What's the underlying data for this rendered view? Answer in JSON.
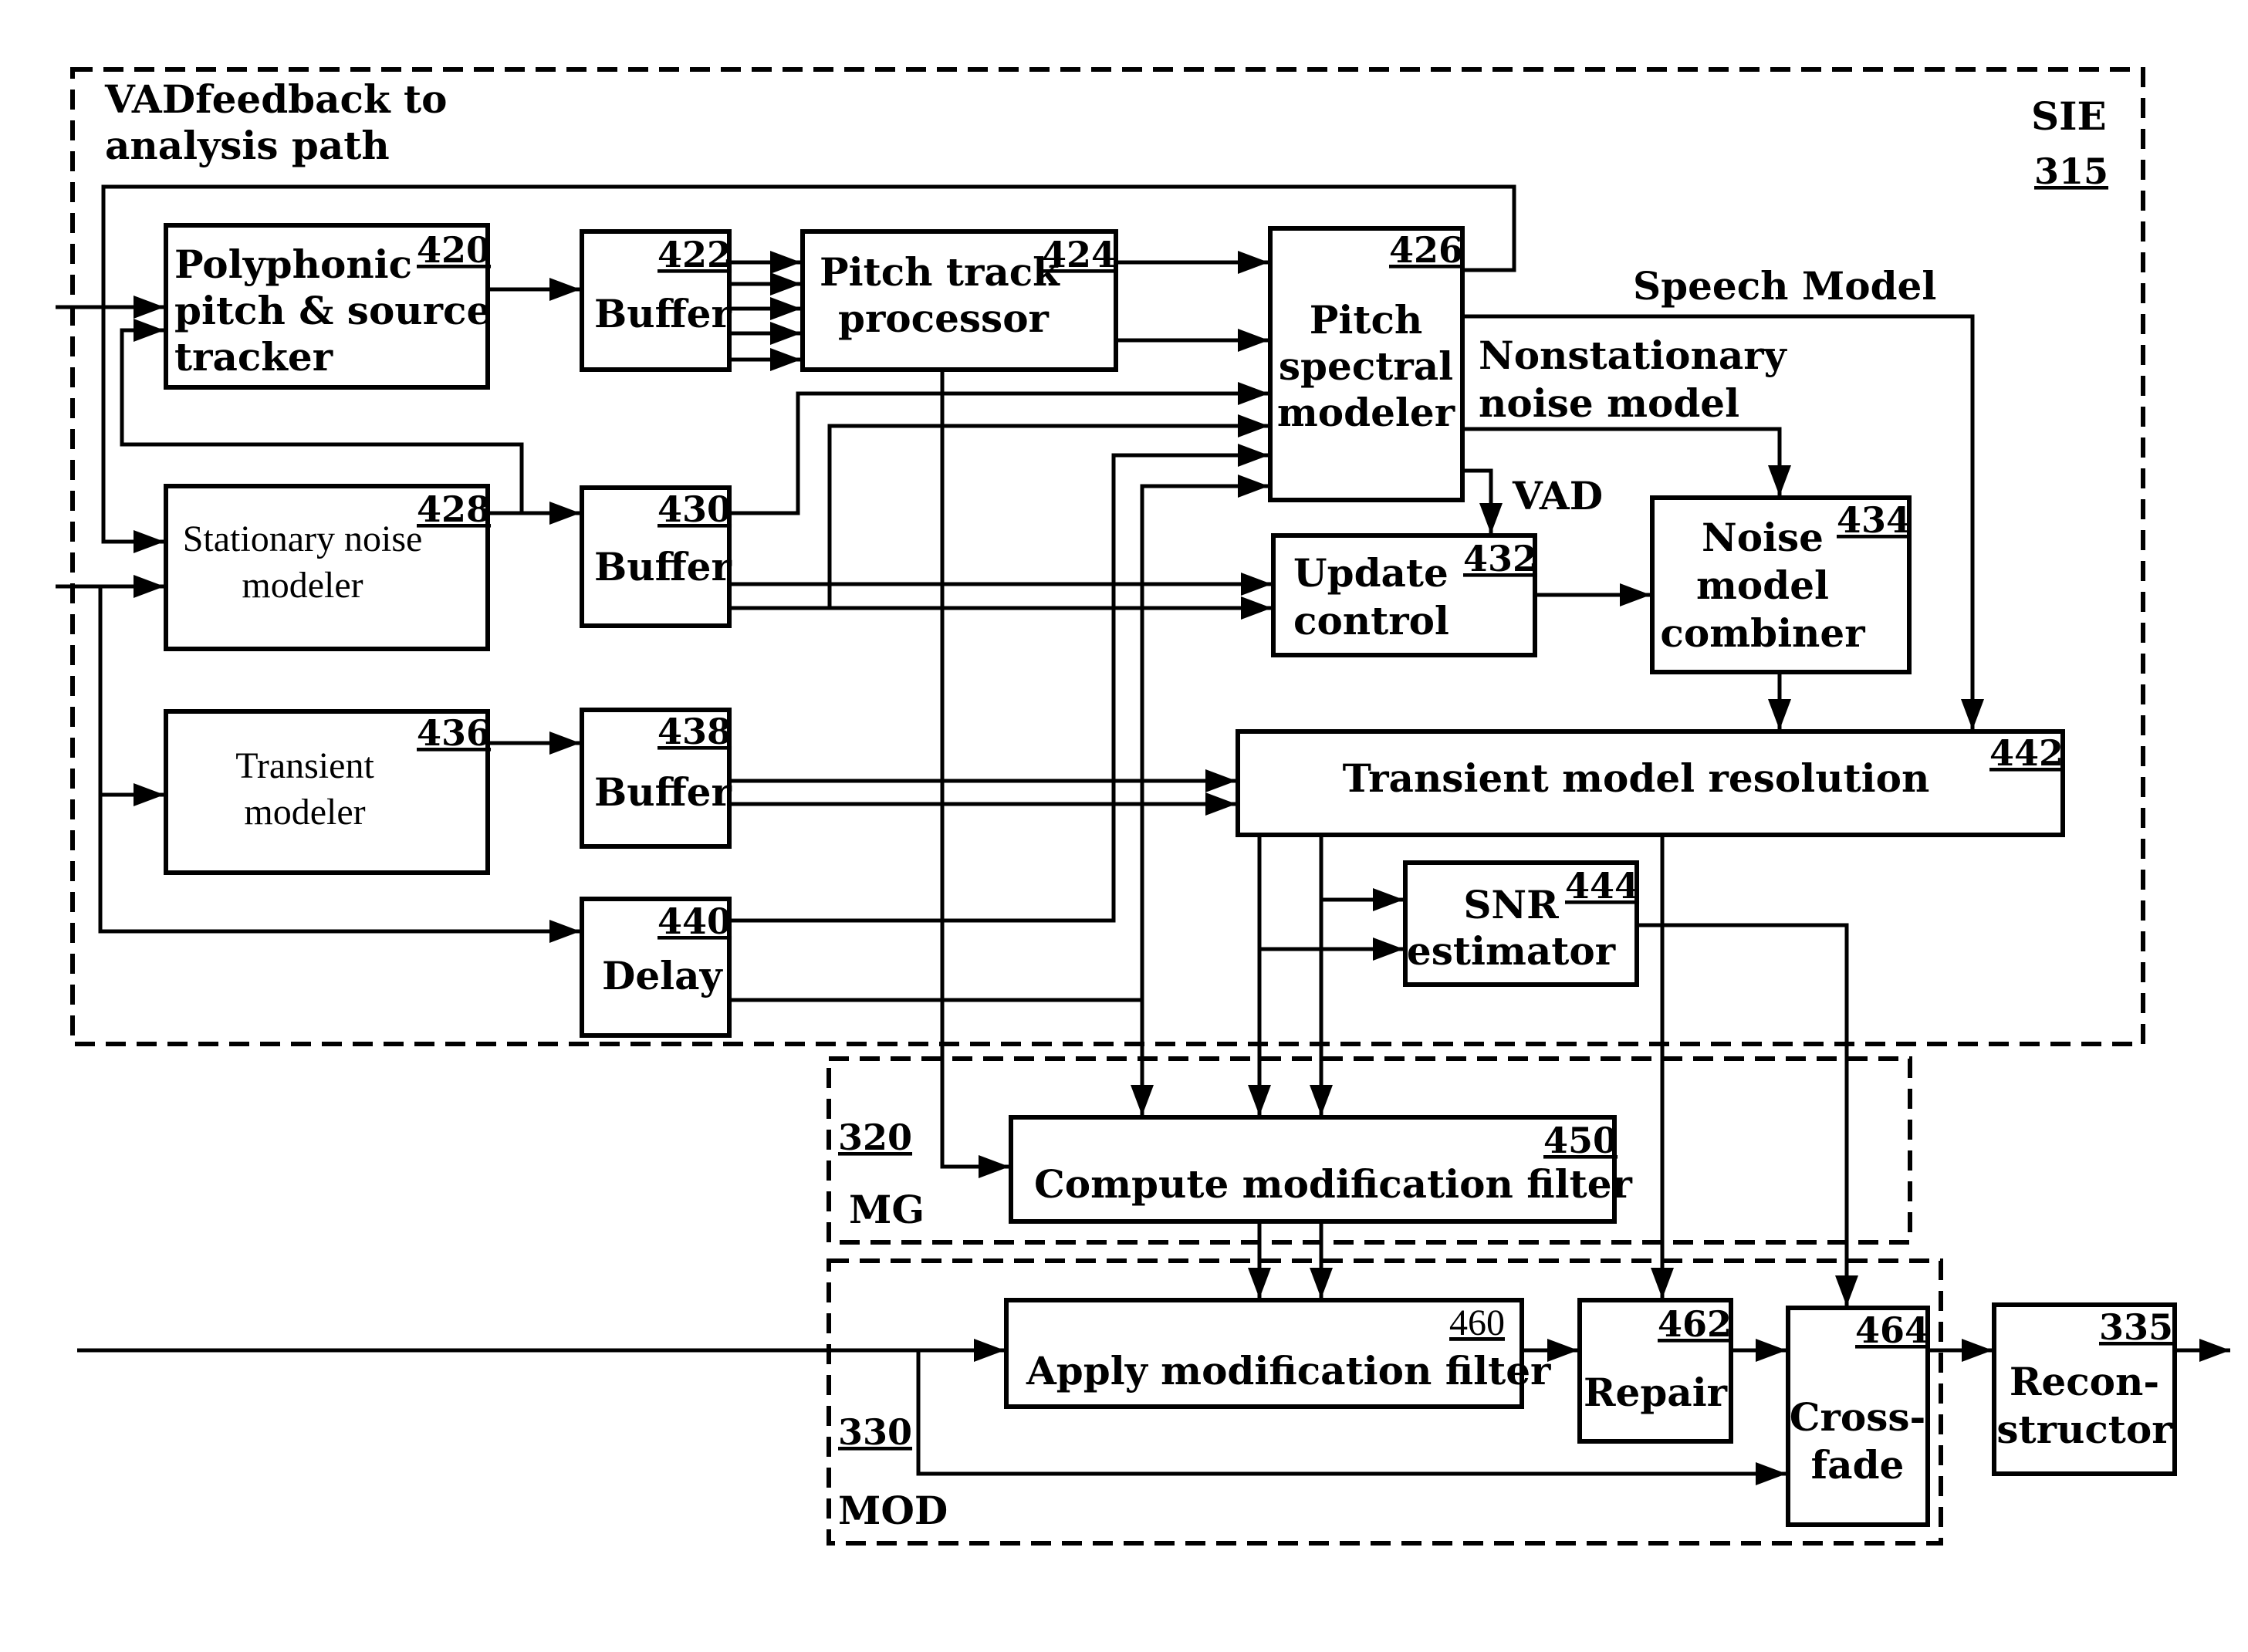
{
  "figure": {
    "groups": [
      {
        "id": "sie",
        "name": "SIE",
        "ref": "315"
      },
      {
        "id": "mg",
        "name": "MG",
        "ref": "320"
      },
      {
        "id": "mod",
        "name": "MOD",
        "ref": "330"
      }
    ],
    "annotations": {
      "vad_feedback_line1": "VADfeedback to",
      "vad_feedback_line2": "analysis path",
      "speech_model": "Speech Model",
      "nonstationary_line1": "Nonstationary",
      "nonstationary_line2": "noise model",
      "vad": "VAD"
    },
    "blocks": {
      "b420": {
        "ref": "420",
        "lines": [
          "Polyphonic",
          "pitch & source",
          "tracker"
        ]
      },
      "b422": {
        "ref": "422",
        "lines": [
          "Buffer"
        ]
      },
      "b424": {
        "ref": "424",
        "lines": [
          "Pitch track",
          "processor"
        ]
      },
      "b426": {
        "ref": "426",
        "lines": [
          "Pitch",
          "spectral",
          "modeler"
        ]
      },
      "b428": {
        "ref": "428",
        "lines": [
          "Stationary noise",
          "modeler"
        ]
      },
      "b430": {
        "ref": "430",
        "lines": [
          "Buffer"
        ]
      },
      "b432": {
        "ref": "432",
        "lines": [
          "Update",
          "control"
        ]
      },
      "b434": {
        "ref": "434",
        "lines": [
          "Noise",
          "model",
          "combiner"
        ]
      },
      "b436": {
        "ref": "436",
        "lines": [
          "Transient",
          "modeler"
        ]
      },
      "b438": {
        "ref": "438",
        "lines": [
          "Buffer"
        ]
      },
      "b440": {
        "ref": "440",
        "lines": [
          "Delay"
        ]
      },
      "b442": {
        "ref": "442",
        "lines": [
          "Transient model resolution"
        ]
      },
      "b444": {
        "ref": "444",
        "lines": [
          "SNR",
          "estimator"
        ]
      },
      "b450": {
        "ref": "450",
        "lines": [
          "Compute modification filter"
        ]
      },
      "b460": {
        "ref": "460",
        "lines": [
          "Apply modification filter"
        ]
      },
      "b462": {
        "ref": "462",
        "lines": [
          "Repair"
        ]
      },
      "b464": {
        "ref": "464",
        "lines": [
          "Cross-",
          "fade"
        ]
      },
      "b335": {
        "ref": "335",
        "lines": [
          "Recon-",
          "structor"
        ]
      }
    }
  }
}
